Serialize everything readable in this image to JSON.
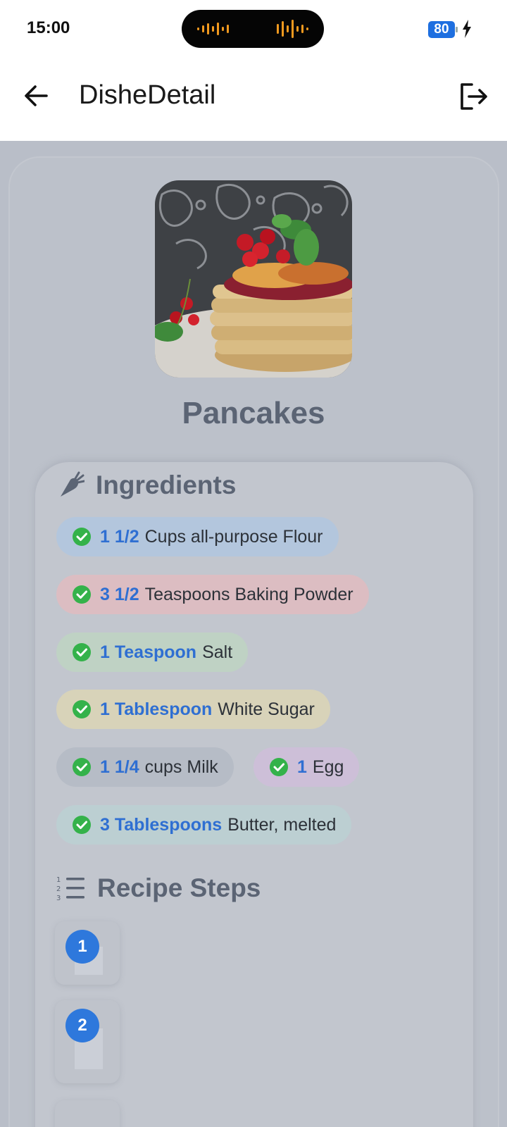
{
  "status_bar": {
    "time": "15:00",
    "battery": "80"
  },
  "app_bar": {
    "title": "DisheDetail"
  },
  "dish": {
    "name": "Pancakes"
  },
  "ingredients": {
    "title": "Ingredients",
    "items": [
      {
        "qty": "1 1/2",
        "name": "Cups all-purpose Flour",
        "color": "#b3c6dd"
      },
      {
        "qty": "3 1/2",
        "name": "Teaspoons Baking Powder",
        "color": "#dcbdc2"
      },
      {
        "qty": "1 Teaspoon",
        "name": "Salt",
        "color": "#bfd2c4"
      },
      {
        "qty": "1 Tablespoon",
        "name": "White Sugar",
        "color": "#d8d3b9"
      },
      {
        "qty": "1 1/4",
        "name": "cups Milk",
        "color": "#b6bcc6"
      },
      {
        "qty": "1",
        "name": "Egg",
        "color": "#cdbfd8"
      },
      {
        "qty": "3 Tablespoons",
        "name": "Butter, melted",
        "color": "#bccfd2"
      }
    ]
  },
  "steps": {
    "title": "Recipe Steps",
    "items": [
      {
        "number": "1"
      },
      {
        "number": "2"
      }
    ]
  }
}
